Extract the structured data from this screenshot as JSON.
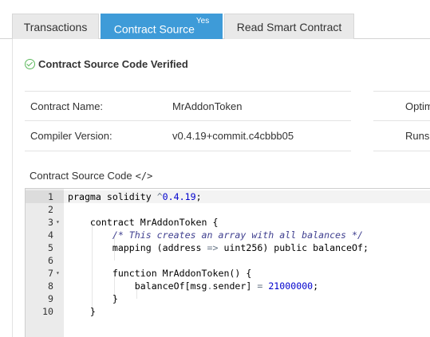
{
  "tabs": [
    {
      "label": "Transactions"
    },
    {
      "label": "Contract Source",
      "badge": "Yes"
    },
    {
      "label": "Read Smart Contract"
    }
  ],
  "verified": {
    "title": "Contract Source Code Verified",
    "icon": "check-circle-icon",
    "color": "#5cb85c"
  },
  "info": {
    "rows": [
      {
        "label": "Contract Name:",
        "value": "MrAddonToken",
        "extra": "Optim"
      },
      {
        "label": "Compiler Version:",
        "value": "v0.4.19+commit.c4cbbb05",
        "extra": "Runs"
      }
    ]
  },
  "code_section": {
    "heading": "Contract Source Code",
    "icon": "</>"
  },
  "code": {
    "lines": [
      {
        "n": "1",
        "fold": "",
        "text": "pragma solidity ^0.4.19;"
      },
      {
        "n": "2",
        "fold": "",
        "text": ""
      },
      {
        "n": "3",
        "fold": "▾",
        "text": "    contract MrAddonToken {"
      },
      {
        "n": "4",
        "fold": "",
        "text": "        /* This creates an array with all balances */"
      },
      {
        "n": "5",
        "fold": "",
        "text": "        mapping (address => uint256) public balanceOf;"
      },
      {
        "n": "6",
        "fold": "",
        "text": ""
      },
      {
        "n": "7",
        "fold": "▾",
        "text": "        function MrAddonToken() {"
      },
      {
        "n": "8",
        "fold": "",
        "text": "            balanceOf[msg.sender] = 21000000;"
      },
      {
        "n": "9",
        "fold": "",
        "text": "        }"
      },
      {
        "n": "10",
        "fold": "",
        "text": "    }"
      }
    ]
  },
  "colors": {
    "accent": "#3e9bd8",
    "verified": "#5cb85c"
  }
}
